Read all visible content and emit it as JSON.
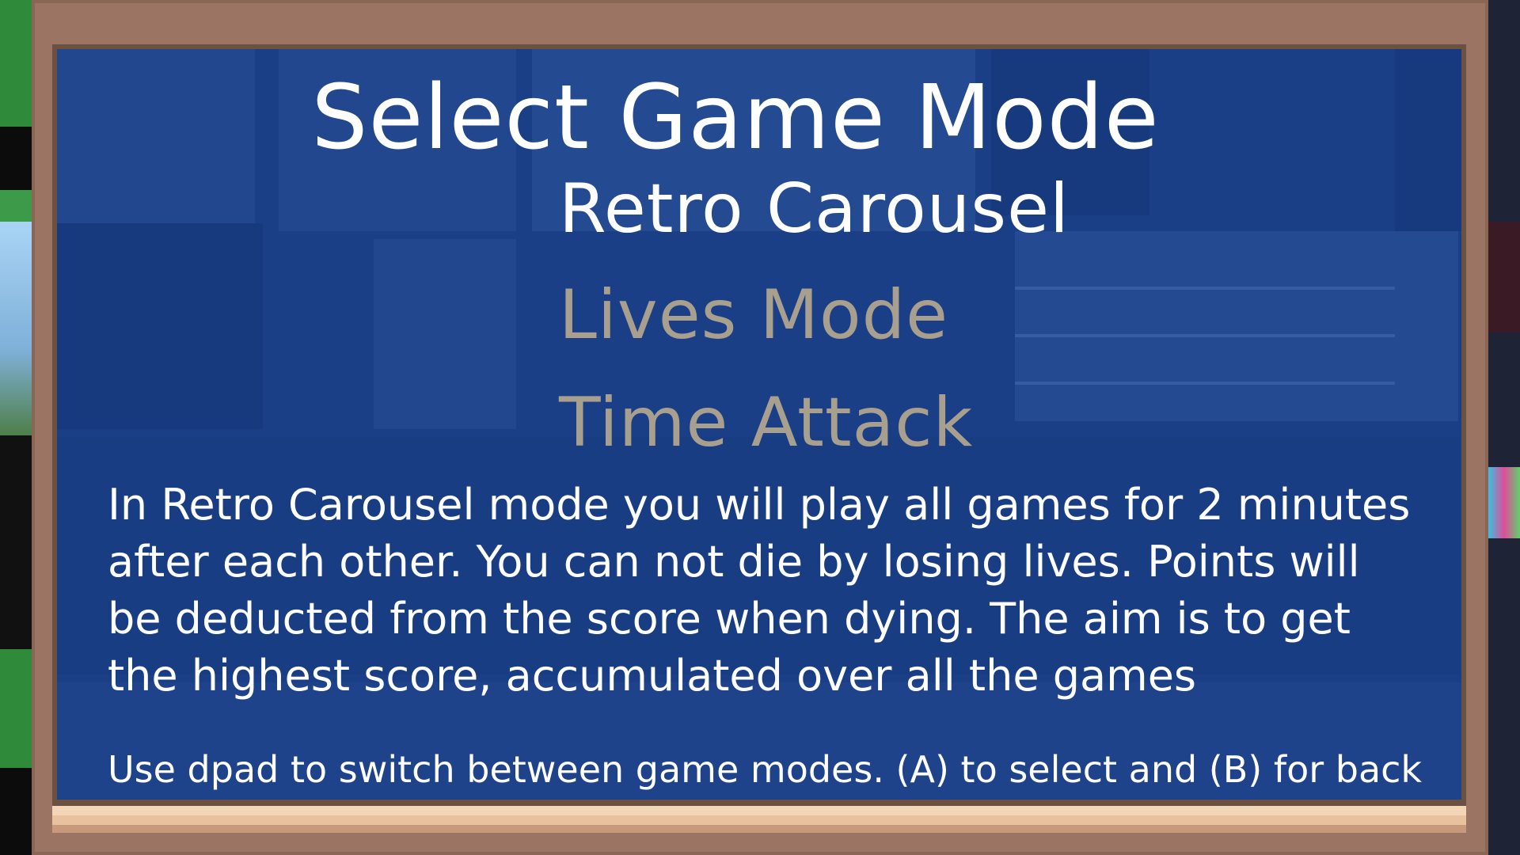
{
  "screen": {
    "title": "Select Game Mode",
    "modes": [
      {
        "label": "Retro Carousel",
        "selected": true
      },
      {
        "label": "Lives Mode",
        "selected": false
      },
      {
        "label": "Time Attack",
        "selected": false
      }
    ],
    "description": "In Retro Carousel mode you will play all games for 2 minutes after each other. You can not die by losing lives. Points will be deducted from the score when dying. The aim is to get the highest score, accumulated over all the games",
    "hint": "Use dpad to switch between game modes. (A) to select and (B) for back"
  },
  "colors": {
    "frame": "#9c7464",
    "screen": "#1a3f86",
    "selected_text": "#ffffff",
    "unselected_text": "#a89f8e"
  }
}
